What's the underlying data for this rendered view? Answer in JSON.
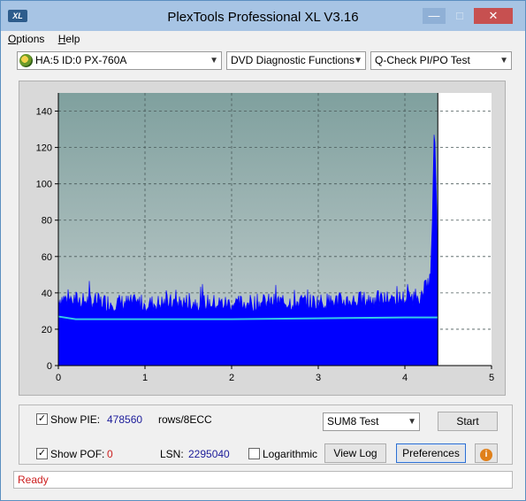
{
  "window": {
    "title": "PlexTools Professional XL V3.16",
    "icon_text": "XL"
  },
  "menu": [
    {
      "label": "Options",
      "accel": "O",
      "rest": "ptions"
    },
    {
      "label": "Help",
      "accel": "H",
      "rest": "elp"
    }
  ],
  "toolbar": {
    "drive": "HA:5 ID:0  PX-760A",
    "function": "DVD Diagnostic Functions",
    "test": "Q-Check PI/PO Test"
  },
  "chart_data": {
    "type": "area",
    "xlim": [
      0,
      5
    ],
    "ylim": [
      0,
      150
    ],
    "x_ticks": [
      0,
      1,
      2,
      3,
      4,
      5
    ],
    "y_ticks": [
      0,
      20,
      40,
      60,
      80,
      100,
      120,
      140
    ],
    "data_end_x": 4.38,
    "grid": true,
    "series": [
      {
        "values_x": [
          0,
          0.5,
          1,
          1.5,
          2,
          2.5,
          3,
          3.5,
          4,
          4.2,
          4.3,
          4.34,
          4.36,
          4.38
        ],
        "values_y": [
          38,
          36,
          35,
          36,
          35,
          36,
          36,
          37,
          38,
          40,
          50,
          130,
          105,
          60
        ]
      },
      {
        "values_x": [
          0,
          0.2,
          1,
          2,
          3,
          4,
          4.38
        ],
        "values_y": [
          27,
          25.5,
          25.5,
          25.5,
          26,
          26.5,
          26.5
        ]
      }
    ],
    "colors": {
      "bars": "#0000ff",
      "avg_line": "#35c8e8",
      "plot_bg_top": "#7fa09e",
      "plot_bg_bottom": "#c6d0d0",
      "cursor": "#000000"
    }
  },
  "controls": {
    "show_pie_label": "Show PIE:",
    "show_pie_checked": "✓",
    "pie_value": "478560",
    "pie_unit": "rows/8ECC",
    "show_poe_label": "Show POF:",
    "show_poe_checked": "✓",
    "poe_value": "0",
    "lsn_label": "LSN:",
    "lsn_value": "2295040",
    "log_label": "Logarithmic",
    "sum_select": "SUM8 Test",
    "start_button": "Start",
    "viewlog_button": "View Log",
    "prefs_button": "Preferences",
    "info_icon": "i"
  },
  "status": {
    "text": "Ready"
  }
}
